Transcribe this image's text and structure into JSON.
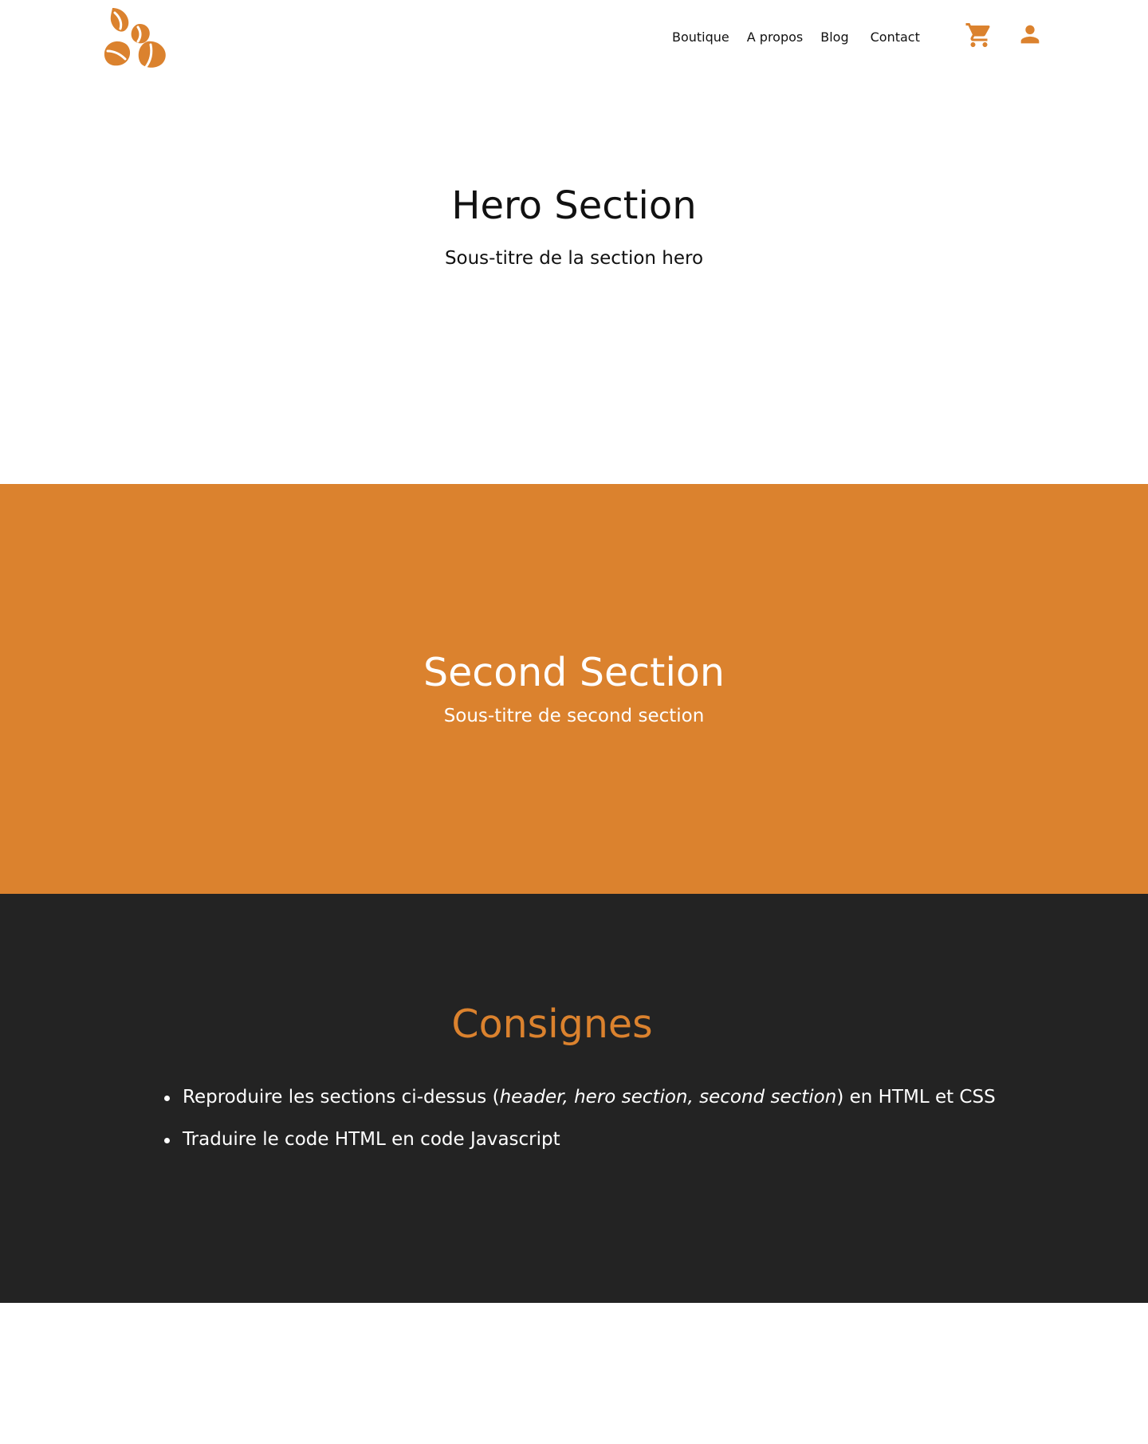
{
  "header": {
    "logo_name": "coffee-beans-logo",
    "nav": [
      {
        "label": "Boutique"
      },
      {
        "label": "A propos"
      },
      {
        "label": "Blog"
      },
      {
        "label": "Contact"
      }
    ],
    "icons": {
      "cart": "cart-icon",
      "user": "user-icon"
    }
  },
  "hero": {
    "title": "Hero Section",
    "subtitle": "Sous-titre de la section hero"
  },
  "second": {
    "title": "Second Section",
    "subtitle": "Sous-titre de second section"
  },
  "consignes": {
    "title": "Consignes",
    "items": [
      {
        "prefix": "Reproduire les sections ci-dessus (",
        "italic": "header, hero section, second section",
        "suffix": ") en HTML et CSS"
      },
      {
        "text": "Traduire le code HTML en code Javascript"
      }
    ]
  },
  "colors": {
    "accent": "#db822e",
    "dark": "#232323",
    "white": "#ffffff",
    "text": "#111111"
  }
}
